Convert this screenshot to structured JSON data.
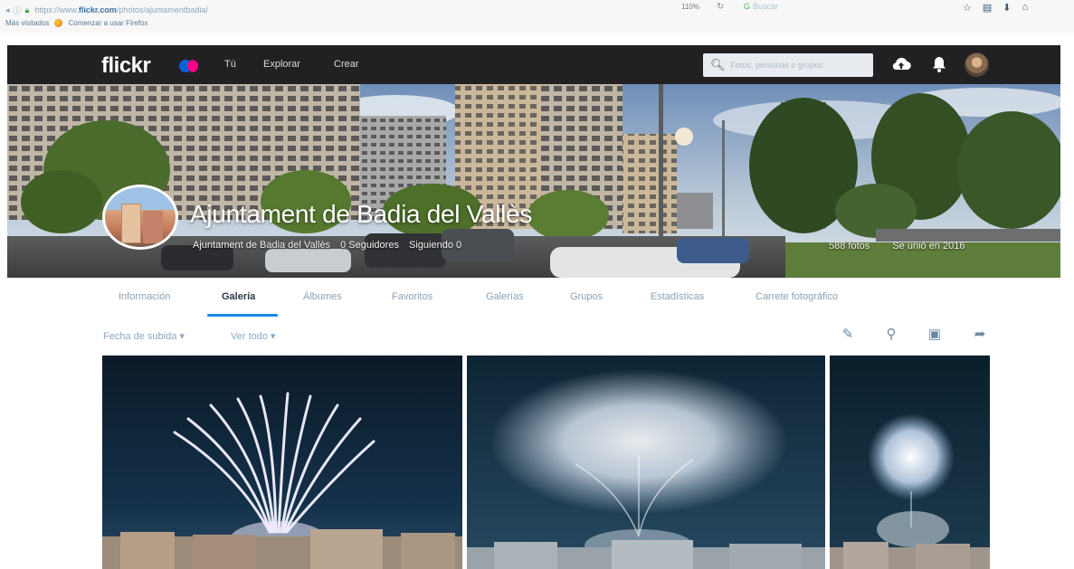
{
  "browser": {
    "url_prefix": "https://www.",
    "url_domain": "flickr.com",
    "url_path": "/photos/ajuntamentbadia/",
    "zoom": "110%",
    "search_placeholder": "Buscar",
    "bookmarks": [
      "Más visitados",
      "Comenzar a usar Firefox"
    ]
  },
  "nav": {
    "logo": "flickr",
    "links": [
      "Tú",
      "Explorar",
      "Crear"
    ],
    "search_placeholder": "Fotos, personas o grupos",
    "colors": {
      "bar": "#212124",
      "logo_blue": "#0063dc",
      "logo_pink": "#ff0084"
    }
  },
  "profile": {
    "name": "Ajuntament de Badia del Vallès",
    "username": "Ajuntament de Badia del Vallès",
    "followers": "0 Seguidores",
    "following": "Siguiendo 0",
    "photos": "588 fotos",
    "joined": "Se unió en 2016"
  },
  "tabs": [
    {
      "label": "Información",
      "active": false
    },
    {
      "label": "Galería",
      "active": true
    },
    {
      "label": "Álbumes",
      "active": false
    },
    {
      "label": "Favoritos",
      "active": false
    },
    {
      "label": "Galerías",
      "active": false
    },
    {
      "label": "Grupos",
      "active": false
    },
    {
      "label": "Estadísticas",
      "active": false
    },
    {
      "label": "Carrete fotográfico",
      "active": false
    }
  ],
  "toolbar": {
    "sort": "Fecha de subida",
    "view": "Ver todo",
    "icons": [
      "edit-icon",
      "search-icon",
      "slideshow-icon",
      "share-icon"
    ]
  },
  "accent_color": "#1e88e5"
}
